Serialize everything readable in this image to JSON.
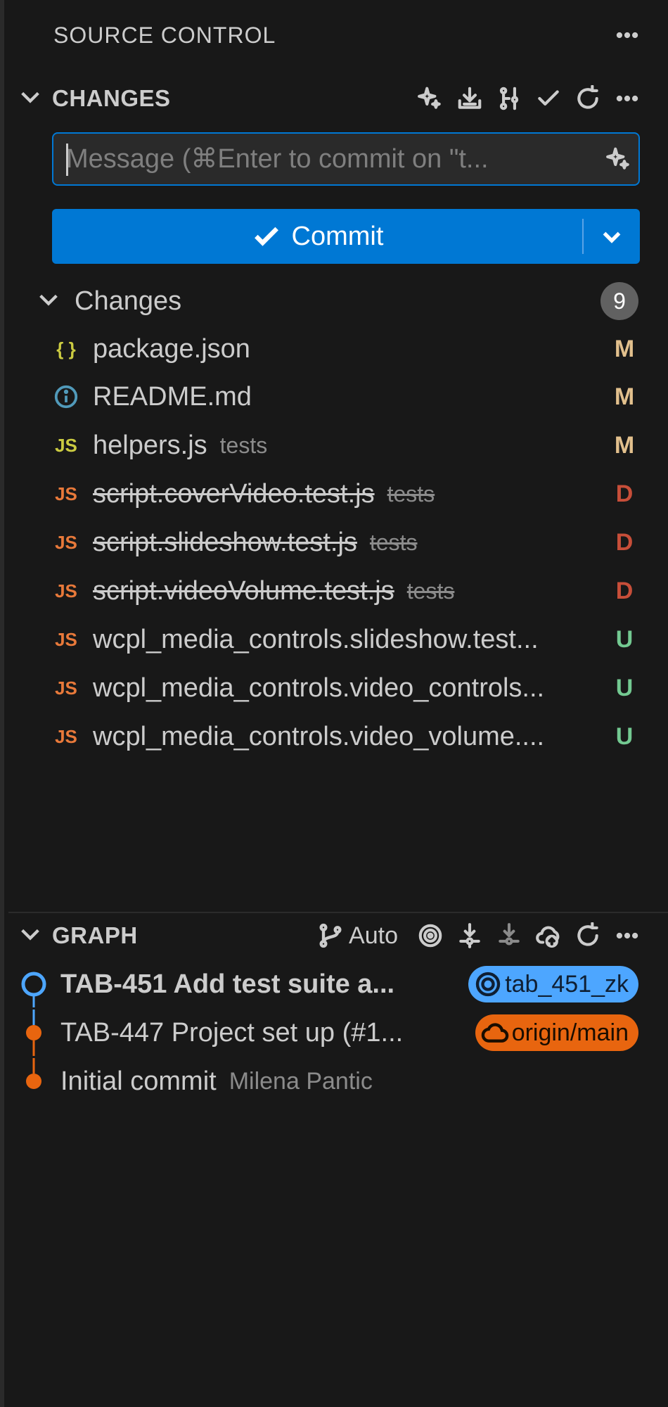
{
  "header": {
    "title": "SOURCE CONTROL",
    "more_icon": "more-horizontal-icon"
  },
  "changes_section": {
    "title": "CHANGES",
    "actions": [
      "sparkle-icon",
      "download-icon",
      "branch-compare-icon",
      "check-icon",
      "refresh-icon",
      "more-horizontal-icon"
    ]
  },
  "commit": {
    "message_placeholder": "Message (⌘Enter to commit on \"t...",
    "button_label": "Commit"
  },
  "changes_group": {
    "label": "Changes",
    "count": "9"
  },
  "files": [
    {
      "name": "package.json",
      "dir": "",
      "status": "M",
      "icon": "json-braces-icon"
    },
    {
      "name": "README.md",
      "dir": "",
      "status": "M",
      "icon": "info-icon"
    },
    {
      "name": "helpers.js",
      "dir": "tests",
      "status": "M",
      "icon": "js-file-icon"
    },
    {
      "name": "script.coverVideo.test.js",
      "dir": "tests",
      "status": "D",
      "icon": "js-file-icon"
    },
    {
      "name": "script.slideshow.test.js",
      "dir": "tests",
      "status": "D",
      "icon": "js-file-icon"
    },
    {
      "name": "script.videoVolume.test.js",
      "dir": "tests",
      "status": "D",
      "icon": "js-file-icon"
    },
    {
      "name": "wcpl_media_controls.slideshow.test...",
      "dir": "",
      "status": "U",
      "icon": "js-file-icon"
    },
    {
      "name": "wcpl_media_controls.video_controls...",
      "dir": "",
      "status": "U",
      "icon": "js-file-icon"
    },
    {
      "name": "wcpl_media_controls.video_volume....",
      "dir": "",
      "status": "U",
      "icon": "js-file-icon"
    }
  ],
  "graph": {
    "title": "GRAPH",
    "auto_label": "Auto",
    "commits": [
      {
        "message": "TAB-451 Add test suite a...",
        "author": "",
        "ref": "tab_451_zk",
        "ref_type": "local"
      },
      {
        "message": "TAB-447 Project set up (#1...",
        "author": "",
        "ref": "origin/main",
        "ref_type": "remote"
      },
      {
        "message": "Initial commit",
        "author": "Milena Pantic",
        "ref": "",
        "ref_type": ""
      }
    ]
  },
  "colors": {
    "accent": "#0078d4",
    "modified": "#e2c08d",
    "deleted": "#c74e39",
    "untracked": "#73c991",
    "graph_head": "#4da6ff",
    "graph_remote": "#e8650f"
  }
}
